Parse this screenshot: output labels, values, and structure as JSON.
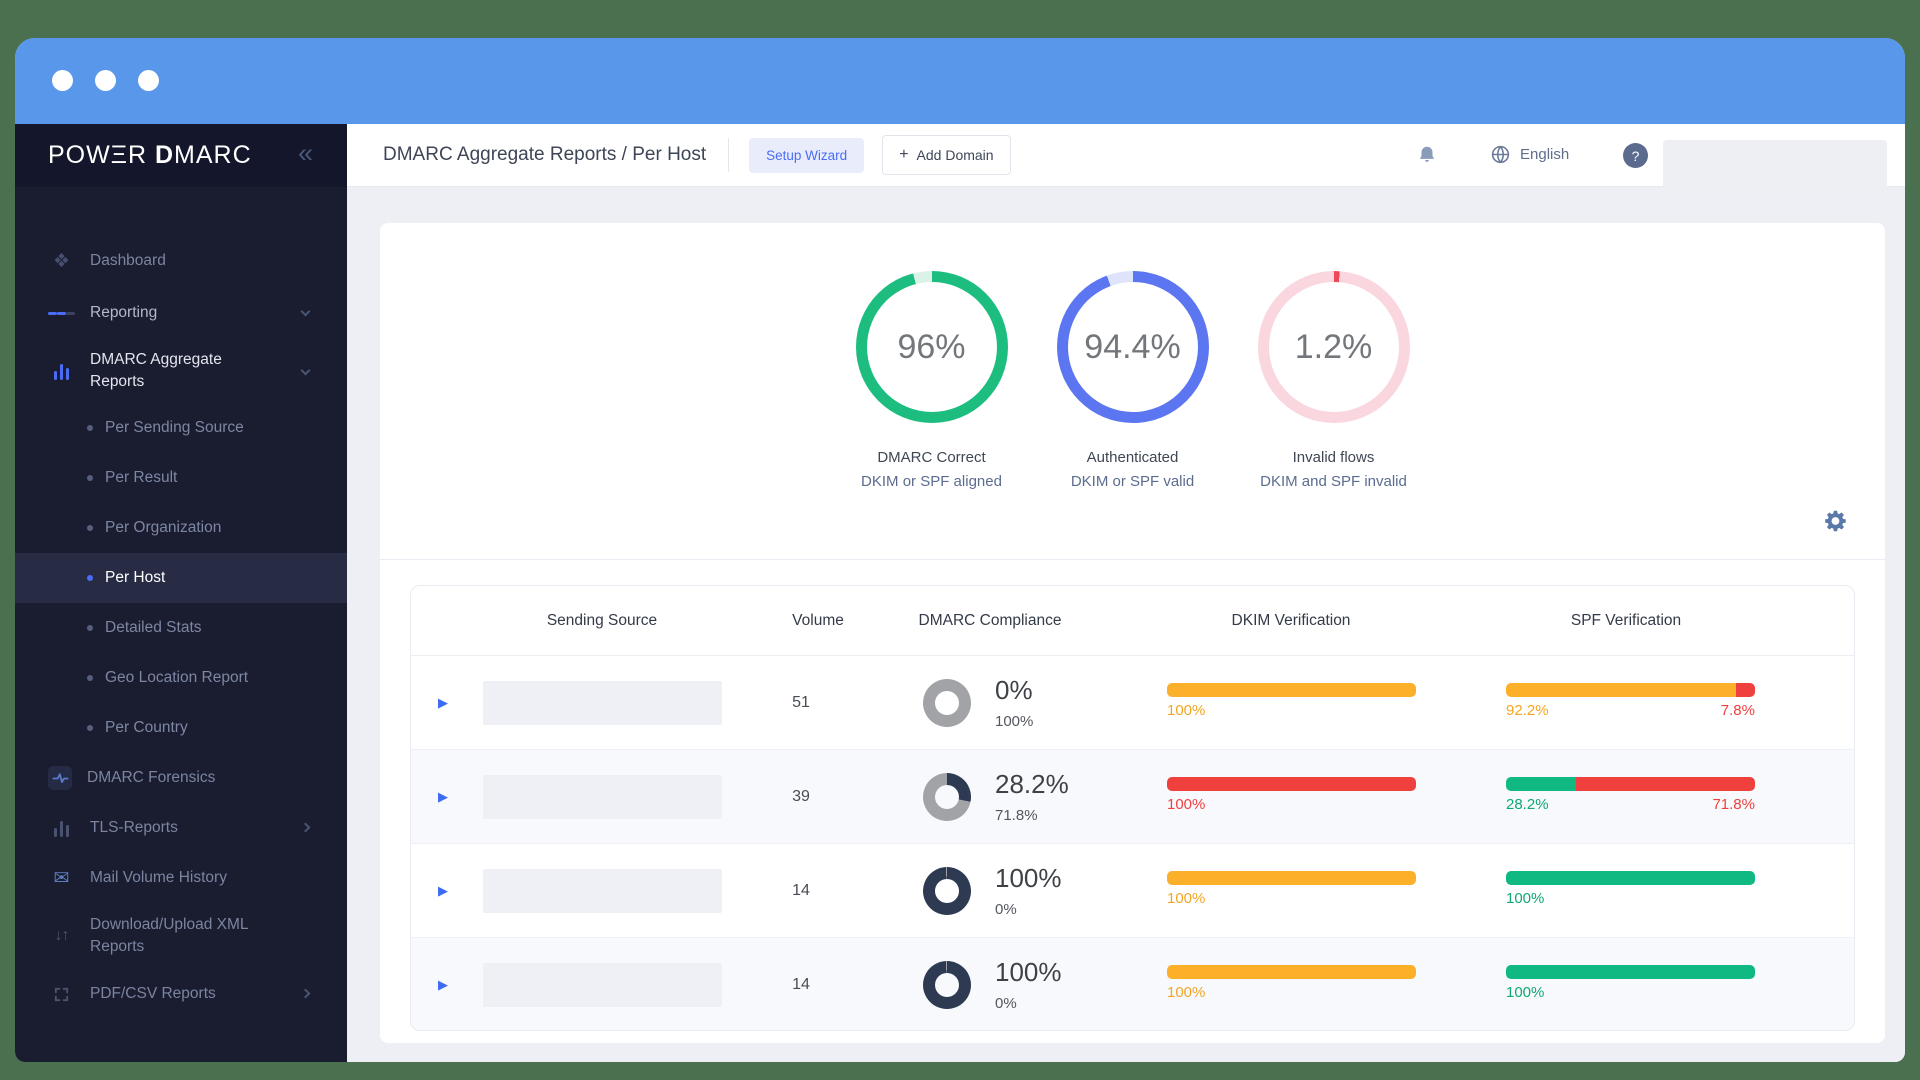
{
  "colors": {
    "titlebar_blue": "#5897e9",
    "background_green": "#4a7050",
    "accent_blue": "#4a6cf7",
    "donut_green": "#1cbd7f",
    "donut_blue": "#5b76f0",
    "donut_pink_track": "#fad6df",
    "donut_red": "#ef4856",
    "bar_amber": "#fcb02a",
    "bar_red": "#f0403d",
    "bar_green": "#10b981",
    "compliance_navy": "#2d3a52",
    "compliance_gray": "#a1a3a7"
  },
  "sidebar": {
    "logo": {
      "part1": "POWΞR",
      "part2": "D",
      "part3": "MARC"
    },
    "collapse_icon": "«",
    "items": [
      {
        "id": "dashboard",
        "label": "Dashboard"
      },
      {
        "id": "reporting",
        "label": "Reporting"
      },
      {
        "id": "dmarc-aggregate-reports",
        "label": "DMARC Aggregate Reports"
      },
      {
        "id": "per-sending-source",
        "label": "Per Sending Source"
      },
      {
        "id": "per-result",
        "label": "Per Result"
      },
      {
        "id": "per-organization",
        "label": "Per Organization"
      },
      {
        "id": "per-host",
        "label": "Per Host"
      },
      {
        "id": "detailed-stats",
        "label": "Detailed Stats"
      },
      {
        "id": "geo-location-report",
        "label": "Geo Location Report"
      },
      {
        "id": "per-country",
        "label": "Per Country"
      },
      {
        "id": "dmarc-forensics",
        "label": "DMARC Forensics"
      },
      {
        "id": "tls-reports",
        "label": "TLS-Reports"
      },
      {
        "id": "mail-volume-history",
        "label": "Mail Volume History"
      },
      {
        "id": "download-upload-xml-reports",
        "label": "Download/Upload XML Reports"
      },
      {
        "id": "pdf-csv-reports",
        "label": "PDF/CSV Reports"
      }
    ]
  },
  "header": {
    "title": "DMARC Aggregate Reports / Per Host",
    "setup_wizard": "Setup Wizard",
    "add_domain": "Add Domain",
    "plus": "+",
    "language": "English",
    "help": "?"
  },
  "overview": {
    "donuts": [
      {
        "value": "96%",
        "donut": {
          "pct": 96,
          "color": "#1cbd7f",
          "track": "#daf2e7"
        },
        "line1": "DMARC Correct",
        "line2": "DKIM or SPF aligned"
      },
      {
        "value": "94.4%",
        "donut": {
          "pct": 94.4,
          "color": "#5b76f0",
          "track": "#dee4fc"
        },
        "line1": "Authenticated",
        "line2": "DKIM or SPF valid"
      },
      {
        "value": "1.2%",
        "donut": {
          "pct": 1.2,
          "color": "#ef4856",
          "track": "#fad6df"
        },
        "line1": "Invalid flows",
        "line2": "DKIM and SPF invalid"
      }
    ]
  },
  "table": {
    "expander": "▶",
    "columns": [
      "Sending Source",
      "Volume",
      "DMARC Compliance",
      "DKIM Verification",
      "SPF Verification"
    ],
    "rows": [
      {
        "volume": "51",
        "compliance": {
          "main": "0%",
          "sub": "100%",
          "donut": {
            "pct": 0,
            "color": "#2d3a52",
            "track": "#a1a3a7"
          }
        },
        "dkim": {
          "segments": [
            {
              "pct": 100,
              "color": "#fcb02a"
            }
          ],
          "labels": [
            {
              "text": "100%",
              "color": "#f2a620"
            }
          ]
        },
        "spf": {
          "segments": [
            {
              "pct": 92.2,
              "color": "#fcb02a"
            },
            {
              "pct": 7.8,
              "color": "#f0403d"
            }
          ],
          "labels": [
            {
              "text": "92.2%",
              "color": "#f2a620"
            },
            {
              "text": "7.8%",
              "color": "#ef403e"
            }
          ]
        }
      },
      {
        "volume": "39",
        "compliance": {
          "main": "28.2%",
          "sub": "71.8%",
          "donut": {
            "pct": 28.2,
            "color": "#2d3a52",
            "track": "#a1a3a7"
          }
        },
        "dkim": {
          "segments": [
            {
              "pct": 100,
              "color": "#f0403d"
            }
          ],
          "labels": [
            {
              "text": "100%",
              "color": "#ef403e"
            }
          ]
        },
        "spf": {
          "segments": [
            {
              "pct": 28.2,
              "color": "#10b981"
            },
            {
              "pct": 71.8,
              "color": "#f0403d"
            }
          ],
          "labels": [
            {
              "text": "28.2%",
              "color": "#0fa873"
            },
            {
              "text": "71.8%",
              "color": "#ef403e"
            }
          ]
        }
      },
      {
        "volume": "14",
        "compliance": {
          "main": "100%",
          "sub": "0%",
          "donut": {
            "pct": 99.2,
            "color": "#2d3a52",
            "track": "#a1a3a7"
          }
        },
        "dkim": {
          "segments": [
            {
              "pct": 100,
              "color": "#fcb02a"
            }
          ],
          "labels": [
            {
              "text": "100%",
              "color": "#f2a620"
            }
          ]
        },
        "spf": {
          "segments": [
            {
              "pct": 100,
              "color": "#10b981"
            }
          ],
          "labels": [
            {
              "text": "100%",
              "color": "#0fa873"
            }
          ]
        }
      },
      {
        "volume": "14",
        "compliance": {
          "main": "100%",
          "sub": "0%",
          "donut": {
            "pct": 99.2,
            "color": "#2d3a52",
            "track": "#a1a3a7"
          }
        },
        "dkim": {
          "segments": [
            {
              "pct": 100,
              "color": "#fcb02a"
            }
          ],
          "labels": [
            {
              "text": "100%",
              "color": "#f2a620"
            }
          ]
        },
        "spf": {
          "segments": [
            {
              "pct": 100,
              "color": "#10b981"
            }
          ],
          "labels": [
            {
              "text": "100%",
              "color": "#0fa873"
            }
          ]
        }
      }
    ]
  }
}
